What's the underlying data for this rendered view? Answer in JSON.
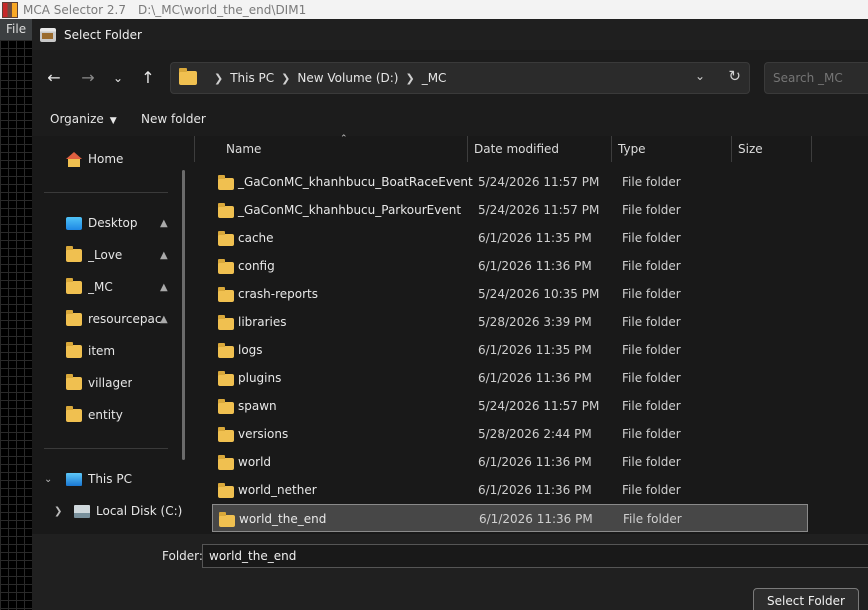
{
  "app": {
    "title": "MCA Selector 2.7",
    "path": "D:\\_MC\\world_the_end\\DIM1",
    "menu_file": "File"
  },
  "dialog": {
    "title": "Select Folder",
    "breadcrumbs": [
      "This PC",
      "New Volume (D:)",
      "_MC"
    ],
    "search_placeholder": "Search _MC",
    "organize_label": "Organize",
    "new_folder_label": "New folder"
  },
  "nav": {
    "home": "Home",
    "quick": [
      {
        "label": "Desktop",
        "icon": "desktop-icon",
        "pinned": true
      },
      {
        "label": "_Love",
        "icon": "folder-icon",
        "pinned": true
      },
      {
        "label": "_MC",
        "icon": "folder-icon",
        "pinned": true
      },
      {
        "label": "resourcepack:",
        "icon": "folder-icon",
        "pinned": true
      },
      {
        "label": "item",
        "icon": "folder-icon",
        "pinned": false
      },
      {
        "label": "villager",
        "icon": "folder-icon",
        "pinned": false
      },
      {
        "label": "entity",
        "icon": "folder-icon",
        "pinned": false
      }
    ],
    "this_pc": "This PC",
    "local_disk": "Local Disk (C:)"
  },
  "columns": {
    "name": "Name",
    "date": "Date modified",
    "type": "Type",
    "size": "Size"
  },
  "files": [
    {
      "name": "_GaConMC_khanhbucu_BoatRaceEvent",
      "date": "5/24/2026 11:57 PM",
      "type": "File folder"
    },
    {
      "name": "_GaConMC_khanhbucu_ParkourEvent",
      "date": "5/24/2026 11:57 PM",
      "type": "File folder"
    },
    {
      "name": "cache",
      "date": "6/1/2026 11:35 PM",
      "type": "File folder"
    },
    {
      "name": "config",
      "date": "6/1/2026 11:36 PM",
      "type": "File folder"
    },
    {
      "name": "crash-reports",
      "date": "5/24/2026 10:35 PM",
      "type": "File folder"
    },
    {
      "name": "libraries",
      "date": "5/28/2026 3:39 PM",
      "type": "File folder"
    },
    {
      "name": "logs",
      "date": "6/1/2026 11:35 PM",
      "type": "File folder"
    },
    {
      "name": "plugins",
      "date": "6/1/2026 11:36 PM",
      "type": "File folder"
    },
    {
      "name": "spawn",
      "date": "5/24/2026 11:57 PM",
      "type": "File folder"
    },
    {
      "name": "versions",
      "date": "5/28/2026 2:44 PM",
      "type": "File folder"
    },
    {
      "name": "world",
      "date": "6/1/2026 11:36 PM",
      "type": "File folder"
    },
    {
      "name": "world_nether",
      "date": "6/1/2026 11:36 PM",
      "type": "File folder"
    },
    {
      "name": "world_the_end",
      "date": "6/1/2026 11:36 PM",
      "type": "File folder",
      "selected": true
    }
  ],
  "footer": {
    "folder_label": "Folder:",
    "folder_value": "world_the_end",
    "select_button": "Select Folder"
  },
  "colors": {
    "folder": "#f0c050",
    "background": "#191919",
    "selection": "#474747"
  }
}
